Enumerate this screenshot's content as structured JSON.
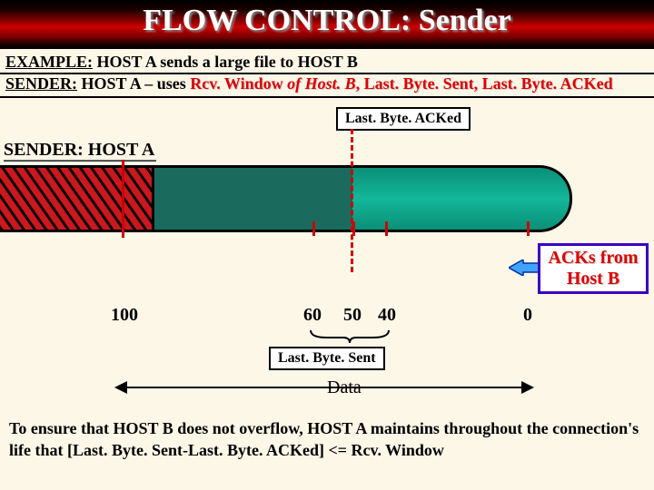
{
  "title": "FLOW CONTROL: Sender",
  "example_prefix": "EXAMPLE:",
  "example_text": " HOST A sends a large file to HOST B",
  "sender_prefix": "SENDER:",
  "sender_host": " HOST A – uses ",
  "var_rcv": "Rcv. Window ",
  "var_of": "of Host. B",
  "var_sep1": ", ",
  "var_sent": "Last. Byte. Sent, ",
  "var_acked": "Last. Byte. ACKed",
  "label_acked": "Last. Byte. ACKed",
  "label_sender_a": "SENDER: HOST A",
  "ticks": {
    "t100": "100",
    "t60": "60",
    "t50": "50",
    "t40": "40",
    "t0": "0"
  },
  "ack_from_b_l1": "ACKs from",
  "ack_from_b_l2": "Host B",
  "label_sent": "Last. Byte. Sent",
  "data_label": "Data",
  "footer": "To ensure that HOST B does not overflow, HOST A maintains throughout the connection's life that [Last. Byte. Sent-Last. Byte. ACKed] <= Rcv. Window"
}
